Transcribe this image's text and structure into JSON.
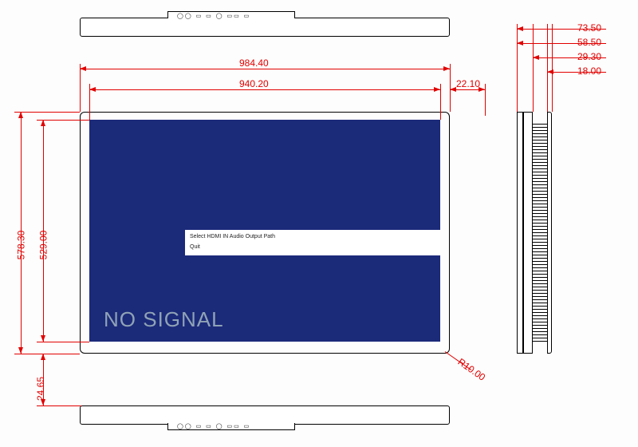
{
  "dimensions": {
    "outer_width": "984.40",
    "inner_width": "940.20",
    "bezel_right": "22.10",
    "outer_height": "578.30",
    "inner_height": "529.00",
    "bottom_gap": "24.65",
    "corner_radius": "R10.00",
    "side_d1": "73.50",
    "side_d2": "58.50",
    "side_d3": "29.30",
    "side_d4": "18.00"
  },
  "screen": {
    "status_text": "NO SIGNAL",
    "menu_title": "Select HDMI IN Audio Output Path",
    "menu_item": "Quit"
  }
}
